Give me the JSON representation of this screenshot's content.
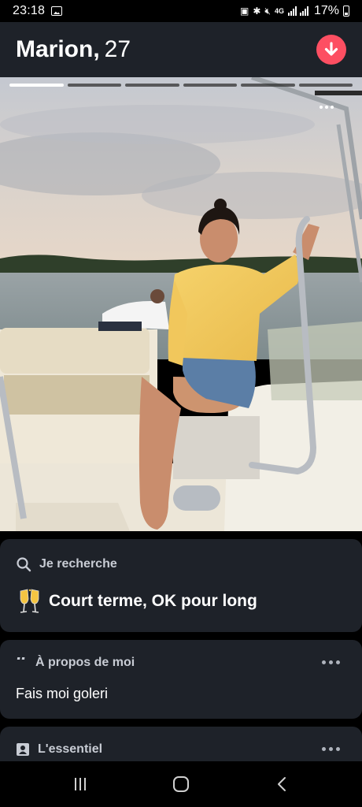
{
  "status_bar": {
    "time": "23:18",
    "network_type": "4G",
    "battery_percent": "17%",
    "icons": [
      "gallery-icon",
      "nfc-icon",
      "bluetooth-icon",
      "mute-icon",
      "signal-icon",
      "battery-icon"
    ]
  },
  "header": {
    "name": "Marion,",
    "age": "27",
    "collapse_icon": "arrow-down-icon",
    "accent_color": "#fd4f62"
  },
  "photo": {
    "total_photos": 6,
    "current_photo": 1,
    "more_icon": "more-horizontal-icon"
  },
  "looking_for": {
    "heading": "Je recherche",
    "heading_icon": "search-icon",
    "value_emoji": "clinking-glasses-emoji",
    "value": "Court terme, OK pour long"
  },
  "about": {
    "heading": "À propos de moi",
    "heading_icon": "quote-icon",
    "text": "Fais moi goleri"
  },
  "essentials": {
    "heading": "L'essentiel",
    "heading_icon": "id-card-icon"
  },
  "colors": {
    "card_bg": "#1e2229",
    "background": "#000000"
  },
  "nav": {
    "icons": [
      "recent-apps-icon",
      "home-icon",
      "back-icon"
    ]
  }
}
